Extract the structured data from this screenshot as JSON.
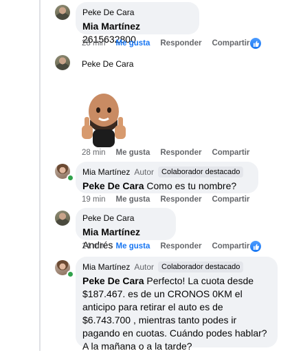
{
  "comments": [
    {
      "author": "Peke De Cara",
      "mention": "Mia Martínez",
      "text": " 2615632800",
      "time": "28 min",
      "like": "Me gusta",
      "reply": "Responder",
      "share": "Compartir"
    },
    {
      "author": "Peke De Cara",
      "time": "28 min",
      "like": "Me gusta",
      "reply": "Responder",
      "share": "Compartir"
    },
    {
      "author": "Mia Martínez",
      "tag": "Autor",
      "badge": "Colaborador destacado",
      "mention": "Peke De Cara",
      "text": " Como es tu nombre?",
      "time": "19 min",
      "like": "Me gusta",
      "reply": "Responder",
      "share": "Compartir"
    },
    {
      "author": "Peke De Cara",
      "mention": "Mia Martínez",
      "text": " Andrés",
      "time": "14 min",
      "like": "Me gusta",
      "reply": "Responder",
      "share": "Compartir"
    },
    {
      "author": "Mia Martínez",
      "tag": "Autor",
      "badge": "Colaborador destacado",
      "mention": "Peke De Cara",
      "text": " Perfecto! La cuota desde $187.467. es de un CRONOS 0KM el anticipo para retirar el auto es de $6.743.700 , mientras tanto podes ir pagando en cuotas. Cuándo podes hablar? A la mañana o a la tarde?"
    }
  ],
  "colors": {
    "bubble": "#f0f2f5",
    "link_blue": "#1876f2",
    "meta_gray": "#65676b"
  }
}
